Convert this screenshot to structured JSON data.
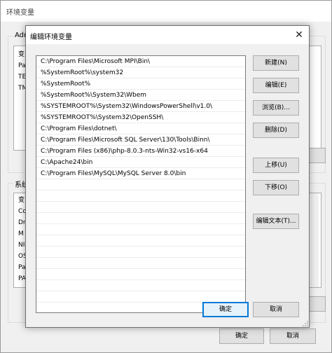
{
  "outer_window": {
    "title": "环境变量",
    "user_group_label": "Adm",
    "user_rows": [
      "变",
      "Pa",
      "TE",
      "TM"
    ],
    "system_group_label": "系统",
    "system_rows": [
      "变",
      "Co",
      "Dr",
      "M",
      "NI",
      "OS",
      "Pa",
      "PA"
    ],
    "ok_label": "确定",
    "cancel_label": "取消"
  },
  "dialog": {
    "title": "编辑环境变量",
    "close_glyph": "✕",
    "paths": [
      "C:\\Program Files\\Microsoft MPI\\Bin\\",
      "%SystemRoot%\\system32",
      "%SystemRoot%",
      "%SystemRoot%\\System32\\Wbem",
      "%SYSTEMROOT%\\System32\\WindowsPowerShell\\v1.0\\",
      "%SYSTEMROOT%\\System32\\OpenSSH\\",
      "C:\\Program Files\\dotnet\\",
      "C:\\Program Files\\Microsoft SQL Server\\130\\Tools\\Binn\\",
      "C:\\Program Files (x86)\\php-8.0.3-nts-Win32-vs16-x64",
      "C:\\Apache24\\bin",
      "C:\\Program Files\\MySQL\\MySQL Server 8.0\\bin"
    ],
    "buttons": {
      "new": "新建(N)",
      "edit": "编辑(E)",
      "browse": "浏览(B)...",
      "delete": "删除(D)",
      "move_up": "上移(U)",
      "move_down": "下移(O)",
      "edit_text": "编辑文本(T)...",
      "ok": "确定",
      "cancel": "取消"
    }
  }
}
